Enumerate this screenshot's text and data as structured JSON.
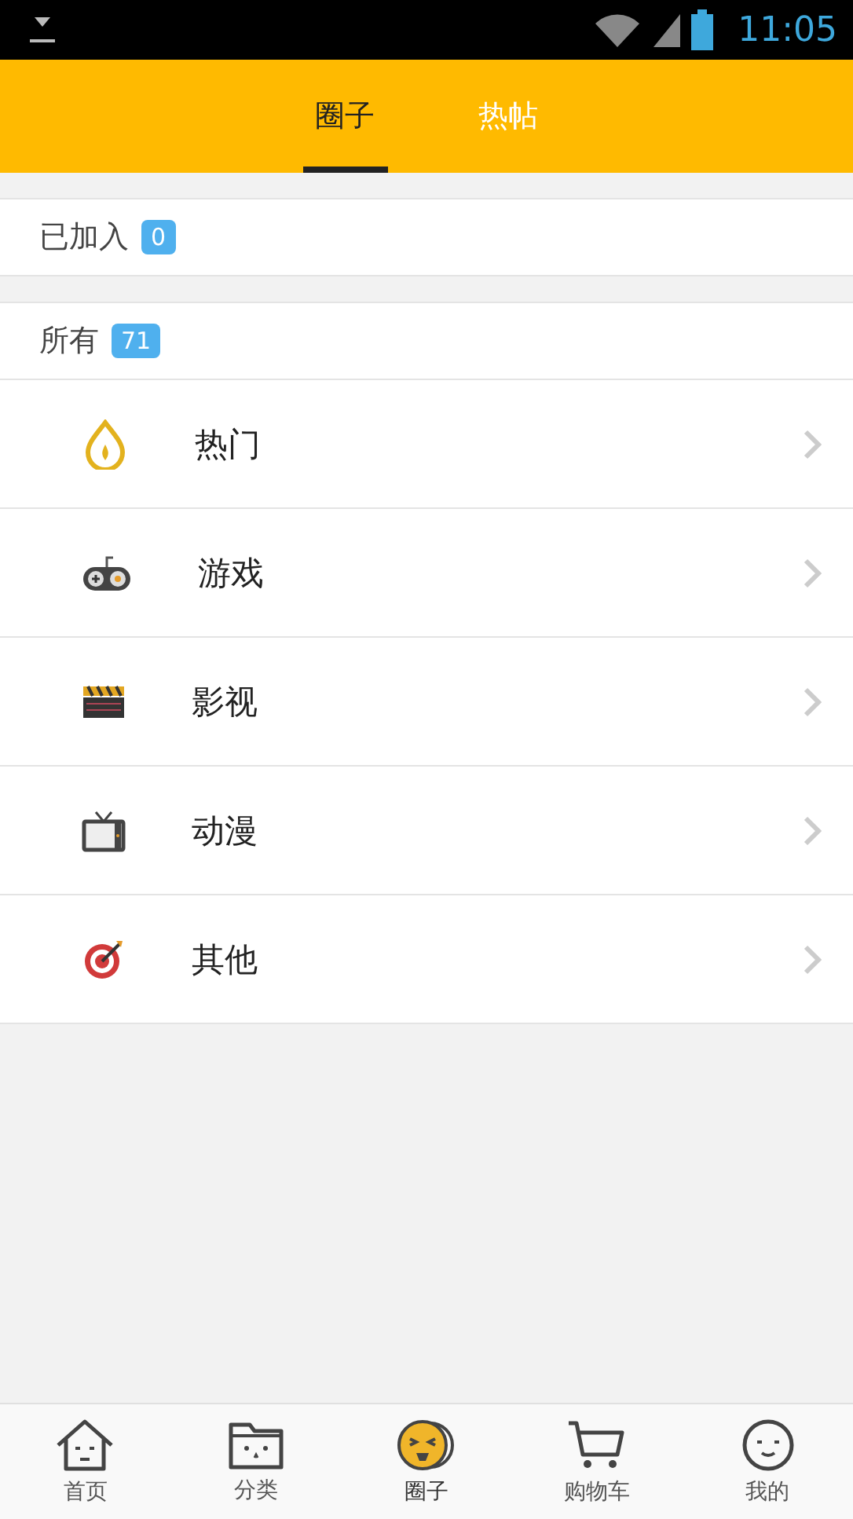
{
  "status_bar": {
    "time": "11:05"
  },
  "tabs": [
    {
      "label": "圈子",
      "selected": true
    },
    {
      "label": "热帖",
      "selected": false
    }
  ],
  "joined": {
    "label": "已加入",
    "count": "0"
  },
  "all": {
    "label": "所有",
    "count": "71"
  },
  "categories": [
    {
      "kind": "flame",
      "label": "热门"
    },
    {
      "kind": "gamepad",
      "label": "游戏"
    },
    {
      "kind": "clapper",
      "label": "影视"
    },
    {
      "kind": "tv",
      "label": "动漫"
    },
    {
      "kind": "target",
      "label": "其他"
    }
  ],
  "bottom_nav": [
    {
      "kind": "house",
      "label": "首页",
      "selected": false
    },
    {
      "kind": "folder",
      "label": "分类",
      "selected": false
    },
    {
      "kind": "face",
      "label": "圈子",
      "selected": true
    },
    {
      "kind": "cart",
      "label": "购物车",
      "selected": false
    },
    {
      "kind": "person",
      "label": "我的",
      "selected": false
    }
  ]
}
